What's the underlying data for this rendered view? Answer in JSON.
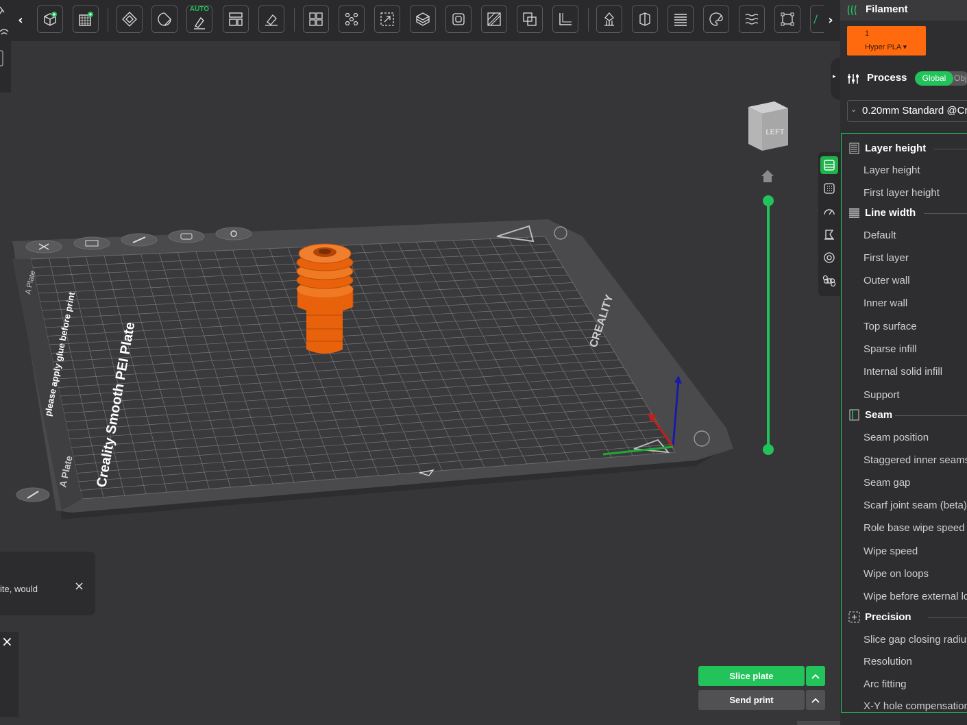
{
  "toolbar": {
    "auto_label": "AUTO",
    "icons": [
      "add-object-icon",
      "add-plate-icon",
      "orient-icon",
      "rotate-icon",
      "auto-arrange-icon",
      "layout-icon",
      "slice-all-icon",
      "split-objects-icon",
      "split-parts-icon",
      "scale-icon",
      "cut-icon",
      "hollow-icon",
      "paint-icon",
      "boolean-icon",
      "measure-icon",
      "support-icon",
      "seam-icon",
      "layer-icon",
      "color-paint-icon",
      "fuzzy-icon",
      "bounding-icon",
      "text-icon"
    ]
  },
  "viewport": {
    "view_cube_label": "LEFT",
    "plate_text": {
      "brand": "Creality Smooth PEI Plate",
      "glue_note": "please apply glue before print",
      "plate_side_a": "A Plate",
      "plate_side_b": "A Plate",
      "logo": "CREALITY"
    }
  },
  "notifications": {
    "partial_text": "ite, would",
    "close": "×",
    "close2": "×"
  },
  "actions": {
    "slice_label": "Slice plate",
    "send_label": "Send print",
    "caret": "^"
  },
  "panel": {
    "filament": {
      "title": "Filament",
      "chip_number": "1",
      "chip_name": "Hyper PLA ▾"
    },
    "process": {
      "title": "Process",
      "toggle_global": "Global",
      "toggle_object": "Obje",
      "preset": "0.20mm Standard @Cr",
      "preset_chevron": "⌄"
    },
    "sections": [
      {
        "title": "Layer height",
        "options": [
          "Layer height",
          "First layer height"
        ]
      },
      {
        "title": "Line width",
        "options": [
          "Default",
          "First layer",
          "Outer wall",
          "Inner wall",
          "Top surface",
          "Sparse infill",
          "Internal solid infill",
          "Support"
        ]
      },
      {
        "title": "Seam",
        "options": [
          "Seam position",
          "Staggered inner seams",
          "Seam gap",
          "Scarf joint seam (beta)",
          "Role base wipe speed",
          "Wipe speed",
          "Wipe on loops",
          "Wipe before external loop"
        ]
      },
      {
        "title": "Precision",
        "options": [
          "Slice gap closing radius",
          "Resolution",
          "Arc fitting",
          "X-Y hole compensation"
        ]
      }
    ]
  },
  "colors": {
    "accent_green": "#23c35b",
    "filament_orange": "#ff6a0e",
    "model_orange": "#e8620c"
  }
}
